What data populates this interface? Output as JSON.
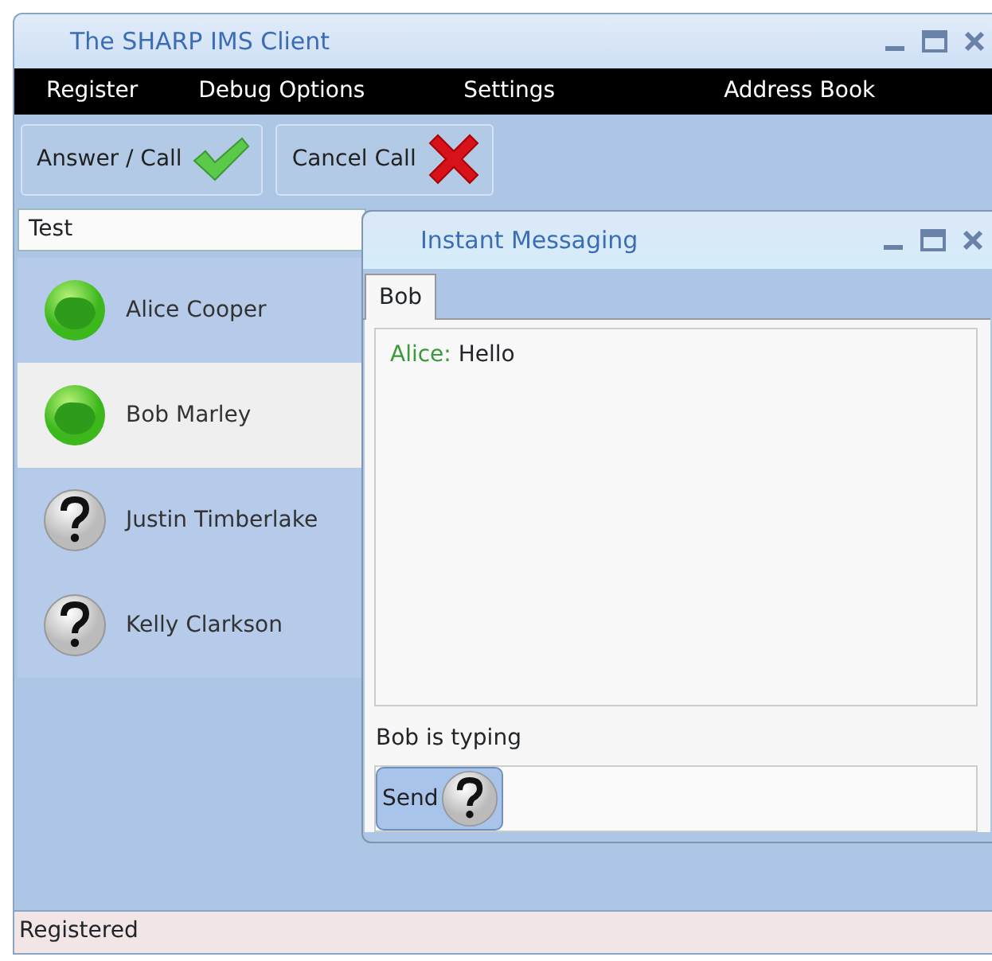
{
  "window": {
    "title": "The SHARP IMS Client"
  },
  "menu": [
    "Register",
    "Debug Options",
    "Settings",
    "Address Book"
  ],
  "toolbar": [
    {
      "label": "Answer / Call",
      "kind": "accept"
    },
    {
      "label": "Cancel Call",
      "kind": "cancel"
    }
  ],
  "contacts": {
    "header": "Test",
    "items": [
      {
        "name": "Alice Cooper",
        "kind": "online",
        "selected": false
      },
      {
        "name": "Bob Marley",
        "kind": "online",
        "selected": true
      },
      {
        "name": "Justin Timberlake",
        "kind": "unknown",
        "selected": false
      },
      {
        "name": "Kelly Clarkson",
        "kind": "unknown",
        "selected": false
      }
    ]
  },
  "im_window": {
    "title": "Instant Messaging",
    "tabs": [
      {
        "label": "Bob",
        "selected": true
      }
    ],
    "messages": [
      {
        "sender": "Alice:",
        "text": "Hello"
      }
    ],
    "typing_status": "Bob is typing",
    "send_button": "Send"
  },
  "status_bar": "Registered"
}
